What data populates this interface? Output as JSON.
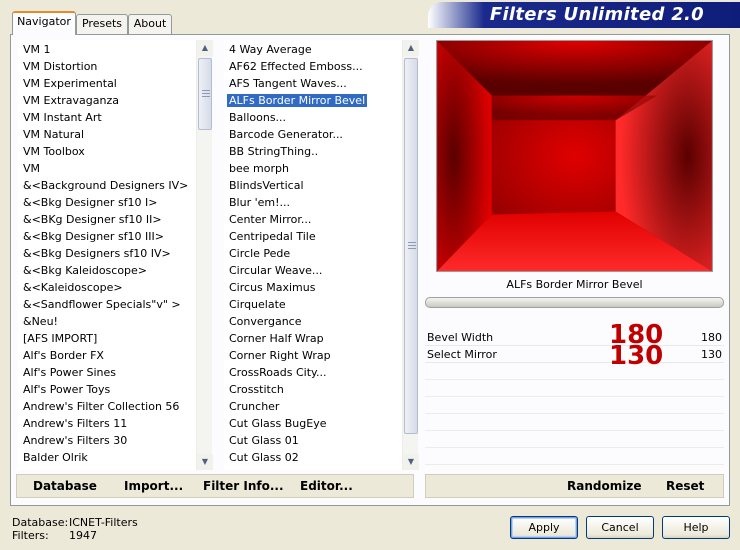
{
  "app": {
    "title": "Filters Unlimited 2.0"
  },
  "tabs": [
    {
      "label": "Navigator",
      "active": true
    },
    {
      "label": "Presets",
      "active": false
    },
    {
      "label": "About",
      "active": false
    }
  ],
  "categories": {
    "items": [
      "VM 1",
      "VM Distortion",
      "VM Experimental",
      "VM Extravaganza",
      "VM Instant Art",
      "VM Natural",
      "VM Toolbox",
      "VM",
      "&<Background Designers IV>",
      "&<Bkg Designer sf10 I>",
      "&<BKg Designer sf10 II>",
      "&<Bkg Designer sf10 III>",
      "&<Bkg Designers sf10 IV>",
      "&<Bkg Kaleidoscope>",
      "&<Kaleidoscope>",
      "&<Sandflower Specials\"v\" >",
      "&Neu!",
      "[AFS IMPORT]",
      "Alf's Border FX",
      "Alf's Power Sines",
      "Alf's Power Toys",
      "Andrew's Filter Collection 56",
      "Andrew's Filters 11",
      "Andrew's Filters 30",
      "Balder Olrik"
    ],
    "selected_index": -1
  },
  "filters": {
    "items": [
      "4 Way Average",
      "AF62 Effected Emboss...",
      "AFS Tangent Waves...",
      "ALFs Border Mirror Bevel",
      "Balloons...",
      "Barcode Generator...",
      "BB StringThing..",
      "bee morph",
      "BlindsVertical",
      "Blur 'em!...",
      "Center Mirror...",
      "Centripedal Tile",
      "Circle Pede",
      "Circular Weave...",
      "Circus Maximus",
      "Cirquelate",
      "Convergance",
      "Corner Half Wrap",
      "Corner Right Wrap",
      "CrossRoads City...",
      "Crosstitch",
      "Cruncher",
      "Cut Glass  BugEye",
      "Cut Glass 01",
      "Cut Glass 02"
    ],
    "selected_index": 3
  },
  "preview": {
    "filter_name": "ALFs Border Mirror Bevel",
    "colors": {
      "base": "#e00000",
      "dark": "#5a0000",
      "light": "#ff2a2a"
    }
  },
  "params": [
    {
      "label": "Bevel Width",
      "value": "180",
      "big_value": "180"
    },
    {
      "label": "Select Mirror",
      "value": "130",
      "big_value": "130"
    }
  ],
  "bottom_left_buttons": {
    "database": "Database",
    "import": "Import...",
    "filter_info": "Filter Info...",
    "editor": "Editor..."
  },
  "bottom_right_buttons": {
    "randomize": "Randomize",
    "reset": "Reset"
  },
  "status": {
    "database_label": "Database:",
    "database_value": "ICNET-Filters",
    "filters_label": "Filters:",
    "filters_value": "1947"
  },
  "dialog_buttons": {
    "apply": "Apply",
    "cancel": "Cancel",
    "help": "Help"
  }
}
